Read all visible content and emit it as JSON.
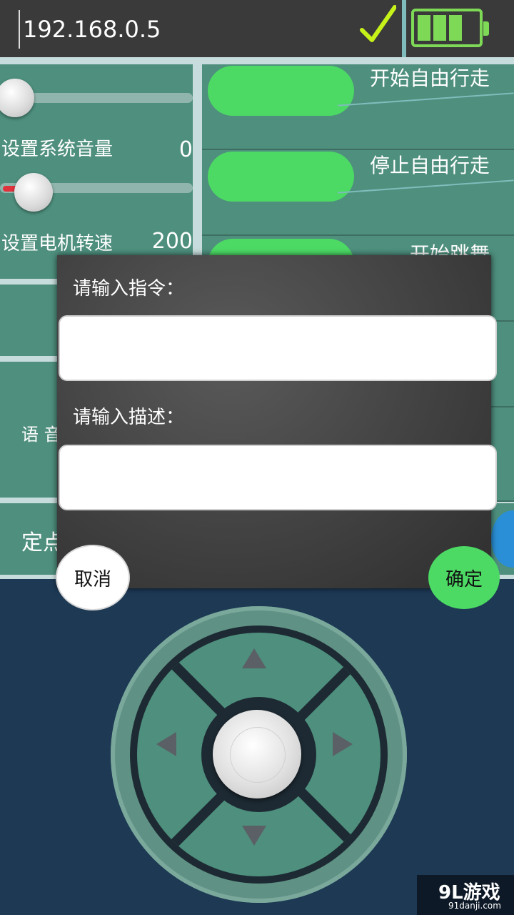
{
  "connection": {
    "ip": "192.168.0.5",
    "status_icon": "checkmark-icon",
    "status_color": "#c6f21a"
  },
  "battery": {
    "color": "#7ed957",
    "bars": 3
  },
  "settings": {
    "volume": {
      "label": "设置系统音量",
      "value": "0",
      "level": 0
    },
    "motor": {
      "label": "设置电机转速",
      "value": "200"
    }
  },
  "actions": [
    {
      "label": "开始自由行走"
    },
    {
      "label": "停止自由行走"
    },
    {
      "label": "开始跳舞"
    }
  ],
  "hidden_labels": {
    "voice": "语 音",
    "fixed": "定点"
  },
  "dialog": {
    "command_label": "请输入指令：",
    "command_value": "",
    "description_label": "请输入描述：",
    "description_value": "",
    "cancel": "取消",
    "confirm": "确定"
  },
  "dpad": {
    "up": "arrow-up-icon",
    "down": "arrow-down-icon",
    "left": "arrow-left-icon",
    "right": "arrow-right-icon"
  },
  "watermark": {
    "brand": "9L游戏",
    "site": "91danji.com"
  },
  "colors": {
    "accent_green": "#4cd964",
    "panel": "#4e8f7d",
    "background": "#1d3954"
  }
}
